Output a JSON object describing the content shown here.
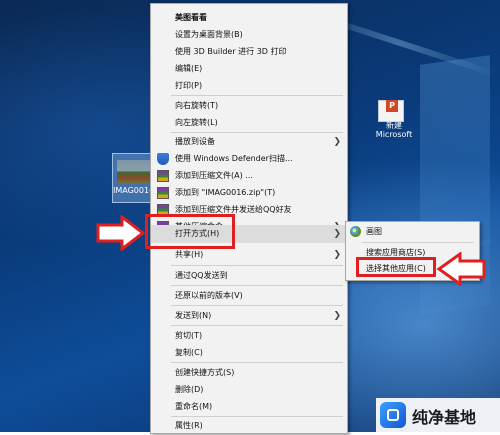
{
  "desktop": {
    "file_label": "IMAG0016",
    "ppt_label_line1": "新建",
    "ppt_label_line2": "Microsoft",
    "ppt_badge": "P"
  },
  "context_menu": {
    "items": [
      {
        "label": "美图看看",
        "bold": true
      },
      {
        "label": "设置为桌面背景(B)"
      },
      {
        "label": "使用 3D Builder 进行 3D 打印"
      },
      {
        "label": "编辑(E)"
      },
      {
        "label": "打印(P)"
      },
      {
        "label": "向右旋转(T)"
      },
      {
        "label": "向左旋转(L)"
      },
      {
        "label": "播放到设备",
        "submenu": true
      },
      {
        "label": "使用 Windows Defender扫描..."
      },
      {
        "label": "添加到压缩文件(A) ..."
      },
      {
        "label": "添加到 \"IMAG0016.zip\"(T)"
      },
      {
        "label": "添加到压缩文件并发送给QQ好友"
      },
      {
        "label": "其他压缩命令",
        "submenu": true
      },
      {
        "label": "打开方式(H)",
        "submenu": true,
        "highlighted": true
      },
      {
        "label": "共享(H)",
        "submenu": true
      },
      {
        "label": "通过QQ发送到"
      },
      {
        "label": "还原以前的版本(V)"
      },
      {
        "label": "发送到(N)",
        "submenu": true
      },
      {
        "label": "剪切(T)"
      },
      {
        "label": "复制(C)"
      },
      {
        "label": "创建快捷方式(S)"
      },
      {
        "label": "删除(D)"
      },
      {
        "label": "重命名(M)"
      },
      {
        "label": "属性(R)"
      }
    ]
  },
  "open_with_submenu": {
    "items": [
      {
        "label": "画图"
      },
      {
        "label": "搜索应用商店(S)"
      },
      {
        "label": "选择其他应用(C)"
      }
    ]
  },
  "watermark": {
    "text": "纯净基地"
  },
  "colors": {
    "annotation_red": "#e02020",
    "menu_bg": "#f2f2f2",
    "menu_highlight": "#dcdcdc"
  }
}
